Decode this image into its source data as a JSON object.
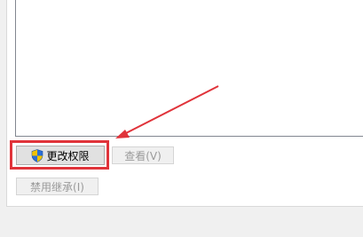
{
  "permissions_panel": {
    "change_permissions_label": "更改权限",
    "view_label": "查看(V)",
    "disable_inheritance_label": "禁用继承(I)"
  },
  "icons": {
    "change_permissions_icon": "uac-shield-icon"
  },
  "colors": {
    "annotation_red": "#e0333a",
    "shield_blue": "#2b6fd6",
    "shield_yellow": "#f2c200"
  }
}
